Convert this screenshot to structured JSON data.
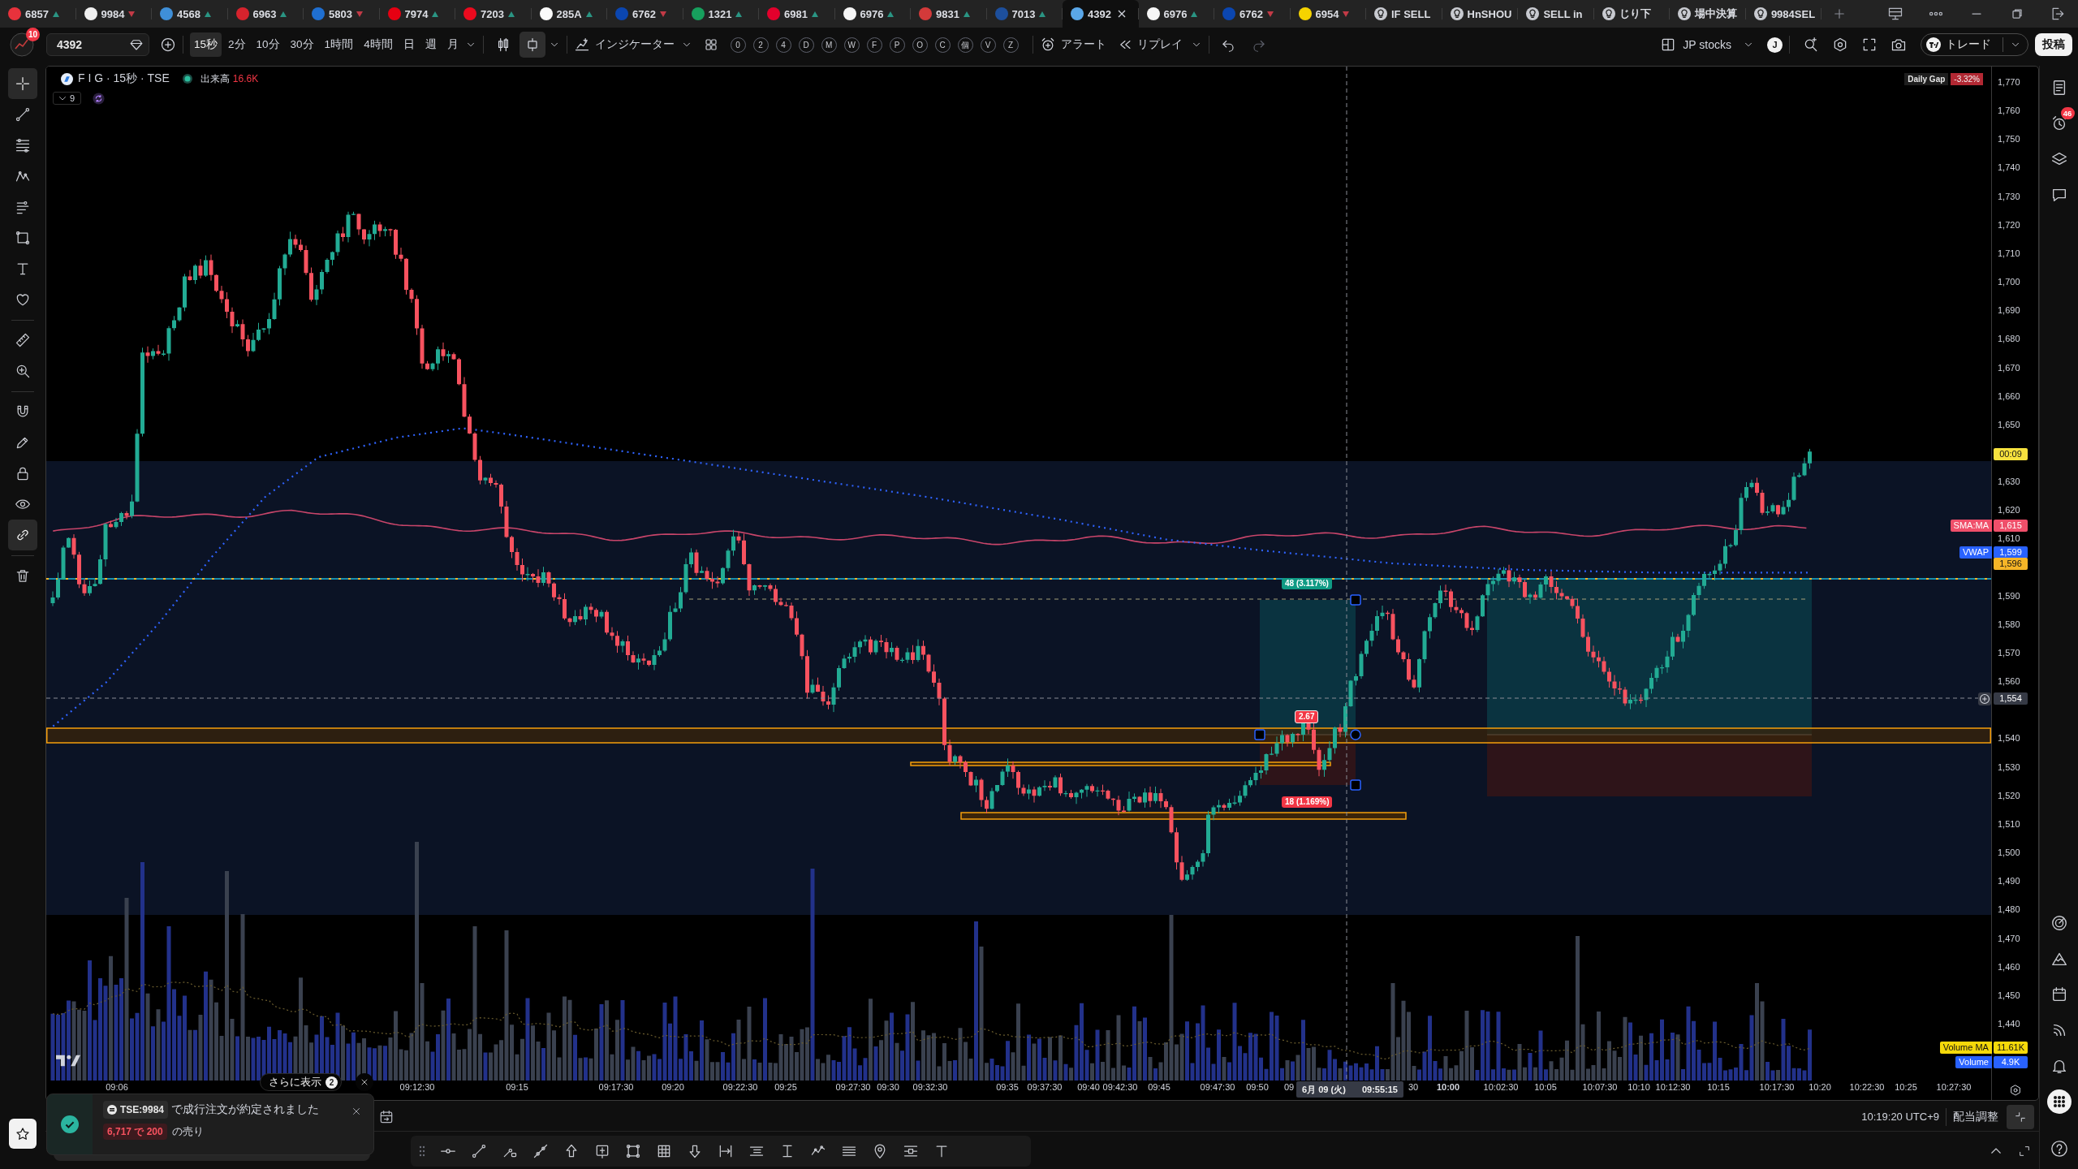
{
  "tabs": [
    {
      "kind": "ticker",
      "label": "6857",
      "up": true,
      "color": "#e8323c",
      "selected": false
    },
    {
      "kind": "ticker",
      "label": "9984",
      "up": false,
      "color": "#f0f0f0",
      "selected": false
    },
    {
      "kind": "ticker",
      "label": "4568",
      "up": true,
      "color": "#3f8fd8",
      "selected": false
    },
    {
      "kind": "ticker",
      "label": "6963",
      "up": true,
      "color": "#d6232d",
      "selected": false
    },
    {
      "kind": "ticker",
      "label": "5803",
      "up": false,
      "color": "#1f6fd1",
      "selected": false
    },
    {
      "kind": "ticker",
      "label": "7974",
      "up": true,
      "color": "#e60012",
      "selected": false
    },
    {
      "kind": "ticker",
      "label": "7203",
      "up": true,
      "color": "#eb0a1e",
      "selected": false
    },
    {
      "kind": "ticker",
      "label": "285A",
      "up": true,
      "color": "#fafafa",
      "selected": false
    },
    {
      "kind": "ticker",
      "label": "6762",
      "up": false,
      "color": "#0b46b0",
      "selected": false
    },
    {
      "kind": "ticker",
      "label": "1321",
      "up": true,
      "color": "#17a05d",
      "selected": false
    },
    {
      "kind": "ticker",
      "label": "6981",
      "up": true,
      "color": "#e3002c",
      "selected": false
    },
    {
      "kind": "ticker",
      "label": "6976",
      "up": true,
      "color": "#f6f6f6",
      "selected": false
    },
    {
      "kind": "ticker",
      "label": "9831",
      "up": true,
      "color": "#d33a3a",
      "selected": false
    },
    {
      "kind": "ticker",
      "label": "7013",
      "up": true,
      "color": "#1d4f9c",
      "selected": false
    },
    {
      "kind": "ticker",
      "label": "4392",
      "color": "#5aa7e8",
      "selected": true
    },
    {
      "kind": "ticker",
      "label": "6976",
      "up": true,
      "color": "#f6f6f6",
      "selected": false
    },
    {
      "kind": "ticker",
      "label": "6762",
      "up": false,
      "color": "#0b46b0",
      "selected": false
    },
    {
      "kind": "ticker",
      "label": "6954",
      "up": false,
      "color": "#f5d300",
      "selected": false
    },
    {
      "kind": "idea",
      "label": "IF SELL",
      "selected": false
    },
    {
      "kind": "idea",
      "label": "HnSHOU",
      "selected": false
    },
    {
      "kind": "idea",
      "label": "SELL in",
      "selected": false
    },
    {
      "kind": "idea",
      "label": "じり下",
      "selected": false
    },
    {
      "kind": "idea",
      "label": "場中決算",
      "selected": false
    },
    {
      "kind": "idea",
      "label": "9984SEL",
      "selected": false
    }
  ],
  "toolbar": {
    "avatar_badge": "10",
    "symbol": "4392",
    "intervals": [
      {
        "label": "15秒",
        "selected": true
      },
      {
        "label": "2分",
        "selected": false
      },
      {
        "label": "10分",
        "selected": false
      },
      {
        "label": "30分",
        "selected": false
      },
      {
        "label": "1時間",
        "selected": false
      },
      {
        "label": "4時間",
        "selected": false
      },
      {
        "label": "日",
        "selected": false
      },
      {
        "label": "週",
        "selected": false
      },
      {
        "label": "月",
        "selected": false
      }
    ],
    "chart_styles": [
      {
        "kind": "candles",
        "selected": false
      },
      {
        "kind": "columns",
        "selected": true
      }
    ],
    "indicators": "インジケーター",
    "quick_buttons": [
      "0",
      "2",
      "4",
      "D",
      "M",
      "W",
      "F",
      "P",
      "O",
      "C",
      "個",
      "V",
      "Z"
    ],
    "alert": "アラート",
    "replay": "リプレイ",
    "layout": "JP stocks",
    "layout_badge": "J",
    "trade": "トレード",
    "publish": "投稿"
  },
  "left_tools": [
    {
      "kind": "crosshair",
      "selected": true
    },
    {
      "kind": "trend-line",
      "selected": false
    },
    {
      "kind": "fib",
      "selected": false
    },
    {
      "kind": "pattern",
      "selected": false
    },
    {
      "kind": "projection",
      "selected": false
    },
    {
      "kind": "rectangle",
      "selected": false
    },
    {
      "kind": "text",
      "selected": false
    },
    {
      "kind": "heart",
      "selected": false
    },
    {
      "kind": "ruler",
      "selected": false
    },
    {
      "kind": "zoom",
      "selected": false
    },
    {
      "kind": "magnet",
      "selected": false
    },
    {
      "kind": "pencil",
      "selected": false
    },
    {
      "kind": "lock",
      "selected": false
    },
    {
      "kind": "eye",
      "selected": false
    },
    {
      "kind": "link",
      "selected": true
    },
    {
      "kind": "trash",
      "selected": false
    }
  ],
  "chart": {
    "title": "F I G · 15秒 · TSE",
    "volume_label": "出来高",
    "volume_value": "16.6K",
    "indicator_count": "9",
    "daily_gap_label": "Daily Gap",
    "daily_gap_value": "-3.32%",
    "price_ticks": [
      "1,770",
      "1,760",
      "1,750",
      "1,740",
      "1,730",
      "1,720",
      "1,710",
      "1,700",
      "1,690",
      "1,680",
      "1,670",
      "1,660",
      "1,650",
      "1,630",
      "1,620",
      "1,610",
      "1,590",
      "1,580",
      "1,570",
      "1,560",
      "1,540",
      "1,530",
      "1,520",
      "1,510",
      "1,500",
      "1,490",
      "1,480",
      "1,470",
      "1,460",
      "1,450",
      "1,440"
    ],
    "price_badges": [
      {
        "kind": "countdown",
        "value": "00:09",
        "color": "#f7e23e"
      },
      {
        "kind": "study",
        "label": "SMA:MA",
        "value": "1,615",
        "color": "#ef4f6a"
      },
      {
        "kind": "study",
        "label": "VWAP",
        "value": "1,599",
        "color": "#2962ff"
      },
      {
        "kind": "line",
        "value": "1,596",
        "color": "#f5b527"
      },
      {
        "kind": "crosshair",
        "value": "1,554",
        "color": "#363a45"
      },
      {
        "kind": "study",
        "label": "Volume MA",
        "value": "11.61K",
        "color": "#f5d90a"
      },
      {
        "kind": "study",
        "label": "Volume",
        "value": "4.9K",
        "color": "#2962ff"
      }
    ],
    "time_ticks": [
      {
        "label": "09:06",
        "major": false
      },
      {
        "label": "09:12:30",
        "major": false
      },
      {
        "label": "09:15",
        "major": false
      },
      {
        "label": "09:17:30",
        "major": false
      },
      {
        "label": "09:20",
        "major": false
      },
      {
        "label": "09:22:30",
        "major": false
      },
      {
        "label": "09:25",
        "major": false
      },
      {
        "label": "09:27:30",
        "major": false
      },
      {
        "label": "09:30",
        "major": false
      },
      {
        "label": "09:32:30",
        "major": false
      },
      {
        "label": "09:35",
        "major": false
      },
      {
        "label": "09:37:30",
        "major": false
      },
      {
        "label": "09:40",
        "major": false
      },
      {
        "label": "09:42:30",
        "major": false
      },
      {
        "label": "09:45",
        "major": false
      },
      {
        "label": "09:47:30",
        "major": false
      },
      {
        "label": "09:50",
        "major": false
      },
      {
        "label": "09",
        "major": false
      },
      {
        "label": "30",
        "major": false
      },
      {
        "label": "10:00",
        "major": true
      },
      {
        "label": "10:02:30",
        "major": false
      },
      {
        "label": "10:05",
        "major": false
      },
      {
        "label": "10:07:30",
        "major": false
      },
      {
        "label": "10:10",
        "major": false
      },
      {
        "label": "10:12:30",
        "major": false
      },
      {
        "label": "10:15",
        "major": false
      },
      {
        "label": "10:17:30",
        "major": false
      },
      {
        "label": "10:20",
        "major": false
      },
      {
        "label": "10:22:30",
        "major": false
      },
      {
        "label": "10:25",
        "major": false
      },
      {
        "label": "10:27:30",
        "major": false
      }
    ],
    "crosshair_date": "6月 09 (火)",
    "crosshair_time": "09:55:15",
    "position": {
      "target": "48 (3.117%)",
      "ratio": "2.67",
      "stop": "18 (1.169%)"
    }
  },
  "status": {
    "clock": "10:19:20 UTC+9",
    "adjust": "配当調整"
  },
  "notice": {
    "more_label": "さらに表示",
    "more_count": "2",
    "symbol": "TSE:9984",
    "message": "で成行注文が約定されました",
    "order": "6,717 で 200",
    "side": "の売り"
  },
  "sidebar": {
    "alerts_badge": "46"
  }
}
